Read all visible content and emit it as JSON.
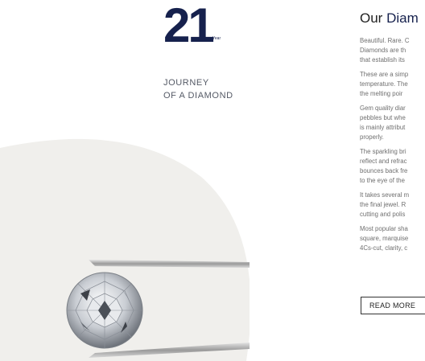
{
  "year": {
    "number": "21",
    "label": "Year"
  },
  "journey": {
    "line1": "JOURNEY",
    "line2": "OF A DIAMOND"
  },
  "section": {
    "title_lead": "Our",
    "title_rest": " Diam",
    "paragraphs": [
      [
        "Beautiful. Rare. C",
        "Diamonds are th",
        "that establish its"
      ],
      [
        "These are a simp",
        "temperature. The",
        "the melting poir"
      ],
      [
        "Gem quality diar",
        "pebbles but whe",
        "is mainly attribut",
        "properly."
      ],
      [
        "The sparkling bri",
        "reflect and refrac",
        "bounces back fre",
        "to the eye of the"
      ],
      [
        "It takes several m",
        "the final jewel. R",
        "cutting and polis"
      ],
      [
        "Most popular sha",
        "square, marquise",
        "4Cs-cut, clarity, c"
      ]
    ]
  },
  "cta": {
    "read_more_label": "READ MORE"
  },
  "illustration": {
    "subject": "diamond-held-by-tweezers",
    "background_color": "#f0efec",
    "accent_color": "#16214d"
  }
}
